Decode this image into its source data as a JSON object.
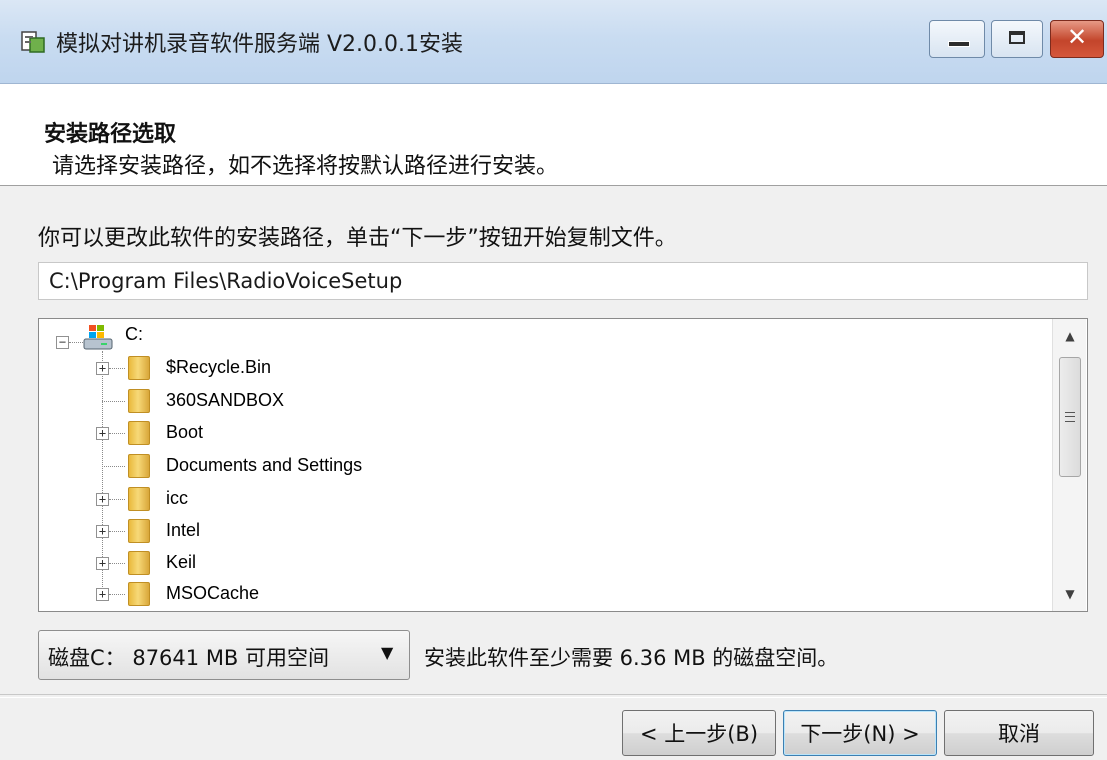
{
  "window": {
    "title": "模拟对讲机录音软件服务端 V2.0.0.1安装",
    "controls": [
      "minimize-icon",
      "maximize-icon",
      "close-icon"
    ],
    "close_glyph": "✕"
  },
  "header": {
    "title": "安装路径选取",
    "subtitle": "请选择安装路径，如不选择将按默认路径进行安装。"
  },
  "main": {
    "instruction": "你可以更改此软件的安装路径，单击“下一步”按钮开始复制文件。",
    "install_path": "C:\\Program Files\\RadioVoiceSetup",
    "tree": {
      "root": {
        "label": "C:",
        "icon": "drive-icon",
        "expanded": true
      },
      "items": [
        {
          "label": "$Recycle.Bin",
          "expandable": true
        },
        {
          "label": "360SANDBOX",
          "expandable": false
        },
        {
          "label": "Boot",
          "expandable": true
        },
        {
          "label": "Documents and Settings",
          "expandable": false
        },
        {
          "label": "icc",
          "expandable": true
        },
        {
          "label": "Intel",
          "expandable": true
        },
        {
          "label": "Keil",
          "expandable": true
        },
        {
          "label": "MSOCache",
          "expandable": true
        }
      ]
    },
    "drive_select": {
      "value": "磁盘C： 87641 MB 可用空间",
      "arrow": "▼"
    },
    "space_required": "安装此软件至少需要 6.36 MB 的磁盘空间。"
  },
  "buttons": {
    "back": "< 上一步(B)",
    "next": "下一步(N) >",
    "cancel": "取消"
  },
  "colors": {
    "titlebar": "#c9dcf1",
    "body": "#f0f0f0",
    "close": "#c3452b",
    "folder": "#f7d978"
  }
}
